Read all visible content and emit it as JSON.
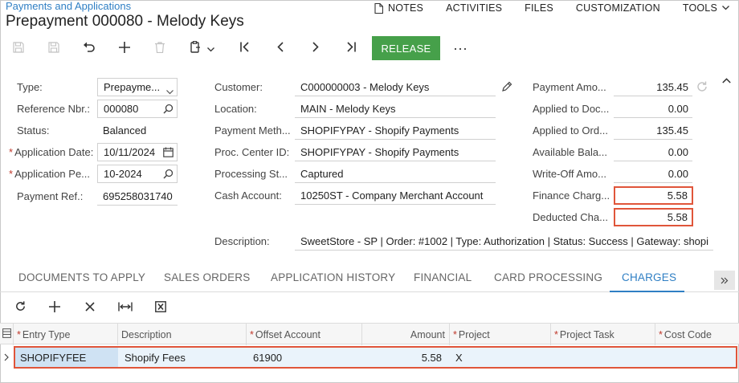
{
  "breadcrumb": "Payments and Applications",
  "title": "Prepayment 000080 - Melody Keys",
  "topnav": [
    {
      "label": "NOTES",
      "icon": "notes-icon"
    },
    {
      "label": "ACTIVITIES"
    },
    {
      "label": "FILES"
    },
    {
      "label": "CUSTOMIZATION"
    },
    {
      "label": "TOOLS",
      "icon": "chevron-down-icon"
    }
  ],
  "toolbar": {
    "release_label": "RELEASE",
    "more_label": "···"
  },
  "form": {
    "type_label": "Type:",
    "type_value": "Prepayme...",
    "refnbr_label": "Reference Nbr.:",
    "refnbr_value": "000080",
    "status_label": "Status:",
    "status_value": "Balanced",
    "appdate_label": "Application Date:",
    "appdate_value": "10/11/2024",
    "appperiod_label": "Application Pe...",
    "appperiod_value": "10-2024",
    "payref_label": "Payment Ref.:",
    "payref_value": "695258031740",
    "customer_label": "Customer:",
    "customer_value": "C000000003 - Melody Keys",
    "location_label": "Location:",
    "location_value": "MAIN - Melody Keys",
    "paymethod_label": "Payment Meth...",
    "paymethod_value": "SHOPIFYPAY - Shopify Payments",
    "proccenter_label": "Proc. Center ID:",
    "proccenter_value": "SHOPIFYPAY - Shopify Payments",
    "procstatus_label": "Processing St...",
    "procstatus_value": "Captured",
    "cashaccount_label": "Cash Account:",
    "cashaccount_value": "10250ST - Company Merchant Account",
    "description_label": "Description:",
    "description_value": "SweetStore - SP | Order: #1002 | Type: Authorization | Status: Success | Gateway: shopi",
    "payamount_label": "Payment Amo...",
    "payamount_value": "135.45",
    "appliedtodoc_label": "Applied to Doc...",
    "appliedtodoc_value": "0.00",
    "appliedtoord_label": "Applied to Ord...",
    "appliedtoord_value": "135.45",
    "availbal_label": "Available Bala...",
    "availbal_value": "0.00",
    "writeoff_label": "Write-Off Amo...",
    "writeoff_value": "0.00",
    "financecharge_label": "Finance Charg...",
    "financecharge_value": "5.58",
    "deductedcharge_label": "Deducted Cha...",
    "deductedcharge_value": "5.58"
  },
  "tabs": [
    "DOCUMENTS TO APPLY",
    "SALES ORDERS",
    "APPLICATION HISTORY",
    "FINANCIAL",
    "CARD PROCESSING",
    "CHARGES"
  ],
  "grid": {
    "columns": {
      "entry_type": "Entry Type",
      "description": "Description",
      "offset_account": "Offset Account",
      "amount": "Amount",
      "project": "Project",
      "project_task": "Project Task",
      "cost_code": "Cost Code"
    },
    "rows": [
      {
        "entry_type": "SHOPIFYFEE",
        "description": "Shopify Fees",
        "offset_account": "61900",
        "amount": "5.58",
        "project": "X",
        "project_task": "",
        "cost_code": ""
      }
    ]
  },
  "colors": {
    "accent": "#2f7fc4",
    "release": "#46a04a",
    "highlight": "#e0553a"
  }
}
